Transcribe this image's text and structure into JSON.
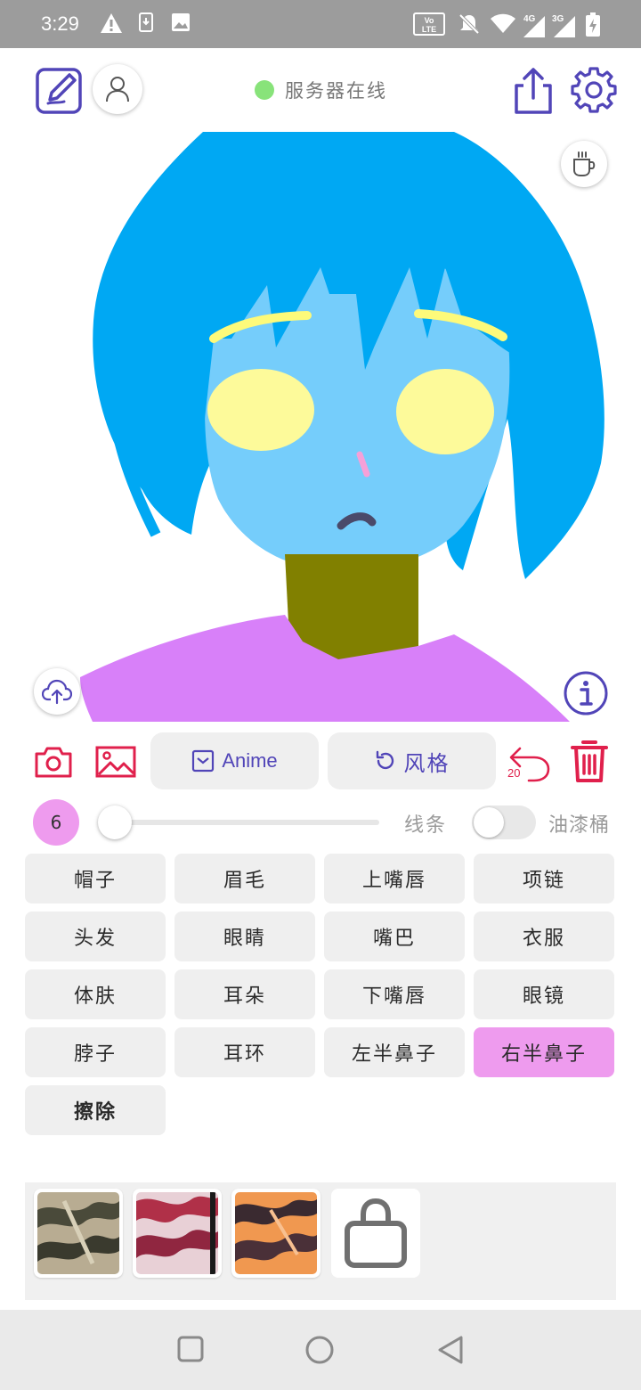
{
  "status_bar": {
    "time": "3:29",
    "icons": [
      "alert-icon",
      "download-icon",
      "image-icon",
      "volte-icon",
      "mute-icon",
      "wifi-icon",
      "signal-4g-icon",
      "signal-3g-icon",
      "battery-charging-icon"
    ],
    "network_4g": "4G",
    "network_3g": "3G"
  },
  "header": {
    "server_status": "服务器在线",
    "status_color": "#88e37a"
  },
  "toolbar": {
    "style_button_label": "Anime",
    "restyle_button_label": "风格",
    "undo_count": "20"
  },
  "controls": {
    "brush_size": "6",
    "line_label": "线条",
    "bucket_label": "油漆桶",
    "bucket_enabled": false,
    "slider_position": 0
  },
  "parts": {
    "hat": "帽子",
    "eyebrows": "眉毛",
    "upper_lip": "上嘴唇",
    "necklace": "项链",
    "hair": "头发",
    "eyes": "眼睛",
    "mouth": "嘴巴",
    "clothes": "衣服",
    "skin": "体肤",
    "ears": "耳朵",
    "lower_lip": "下嘴唇",
    "glasses": "眼镜",
    "neck": "脖子",
    "earrings": "耳环",
    "left_nose": "左半鼻子",
    "right_nose": "右半鼻子",
    "erase": "擦除",
    "selected": "右半鼻子"
  },
  "colors": {
    "accent": "#5145b8",
    "danger": "#e0204c",
    "selected_part": "#ee9bee",
    "hair": "#00a8f3",
    "skin": "#75cdfb",
    "eyes": "#fdfa9a",
    "neck": "#818000",
    "clothes": "#d880f9"
  }
}
